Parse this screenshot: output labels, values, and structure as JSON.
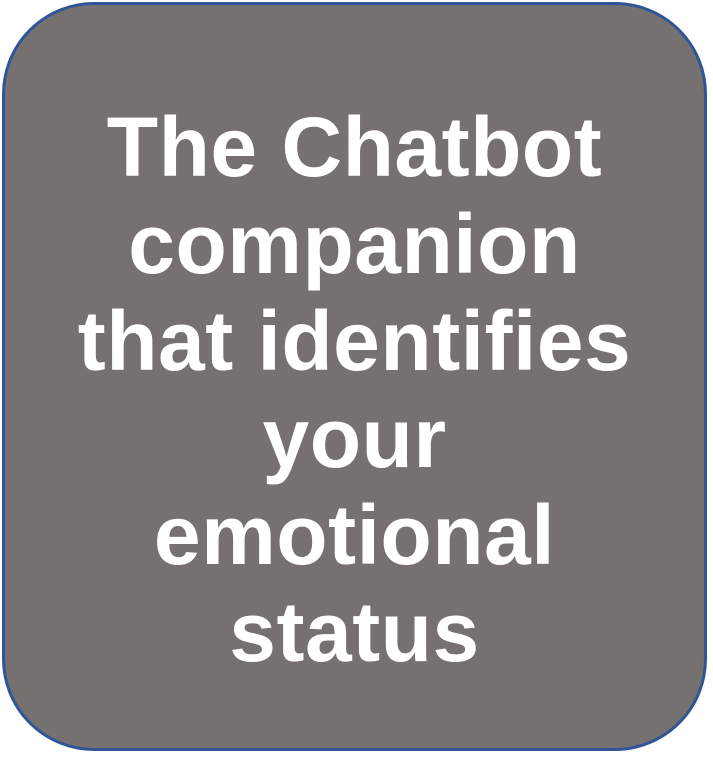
{
  "card": {
    "lines": [
      "The Chatbot",
      "companion",
      "that identifies",
      "your",
      "emotional",
      "status"
    ]
  },
  "colors": {
    "background": "#767171",
    "border": "#2f5597",
    "text": "#ffffff"
  }
}
